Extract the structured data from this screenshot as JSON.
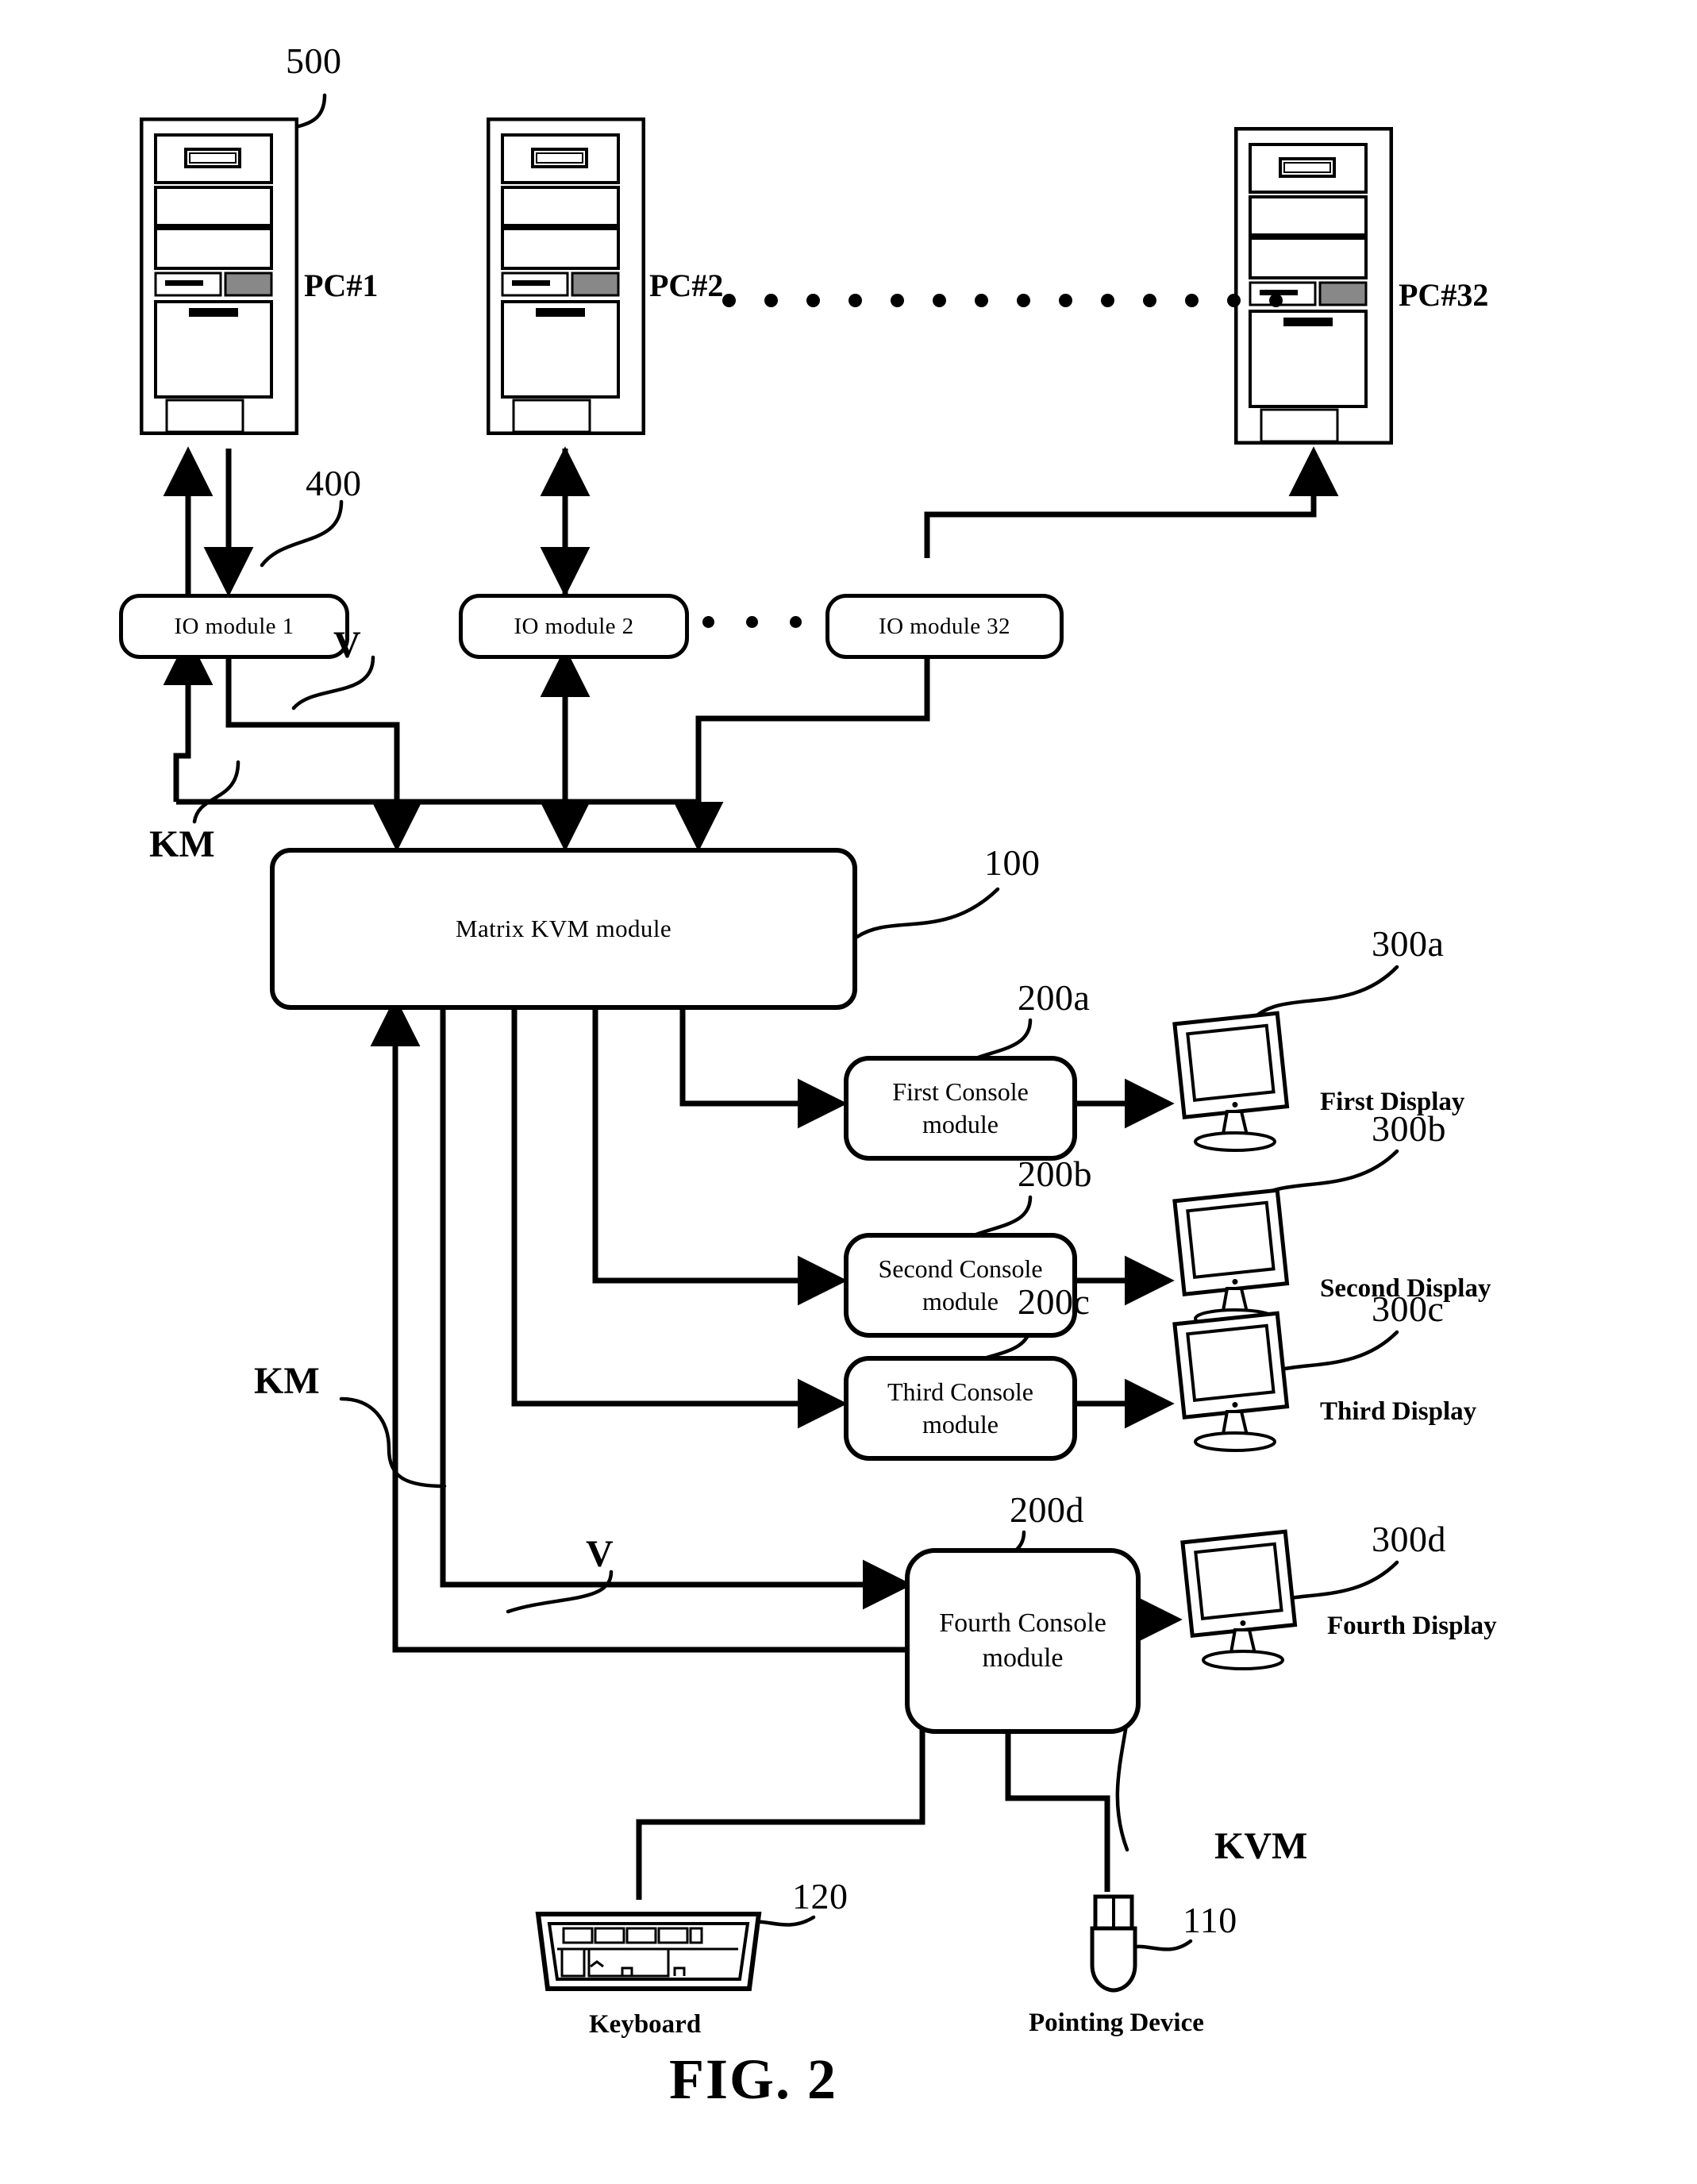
{
  "figure": {
    "caption": "FIG. 2"
  },
  "computers": {
    "ref": "500",
    "items": [
      {
        "label": "PC#1"
      },
      {
        "label": "PC#2"
      },
      {
        "label": "PC#32"
      }
    ],
    "ellipsis_dots": 14
  },
  "io_modules": {
    "ref": "400",
    "items": [
      {
        "label": "IO module 1"
      },
      {
        "label": "IO module 2"
      },
      {
        "label": "IO module 32"
      }
    ],
    "ellipsis_dots": 3
  },
  "matrix": {
    "ref": "100",
    "label": "Matrix KVM module"
  },
  "consoles": [
    {
      "ref": "200a",
      "line1": "First Console",
      "line2": "module"
    },
    {
      "ref": "200b",
      "line1": "Second Console",
      "line2": "module"
    },
    {
      "ref": "200c",
      "line1": "Third Console",
      "line2": "module"
    },
    {
      "ref": "200d",
      "line1": "Fourth Console",
      "line2": "module"
    }
  ],
  "displays": [
    {
      "ref": "300a",
      "label": "First Display"
    },
    {
      "ref": "300b",
      "label": "Second Display"
    },
    {
      "ref": "300c",
      "label": "Third Display"
    },
    {
      "ref": "300d",
      "label": "Fourth Display"
    }
  ],
  "peripherals": {
    "keyboard": {
      "ref": "120",
      "label": "Keyboard"
    },
    "pointing_device": {
      "ref": "110",
      "label": "Pointing Device"
    }
  },
  "signal_labels": {
    "video_top": "V",
    "km_top": "KM",
    "km_bottom": "KM",
    "video_bottom": "V",
    "kvm_bundle": "KVM"
  }
}
